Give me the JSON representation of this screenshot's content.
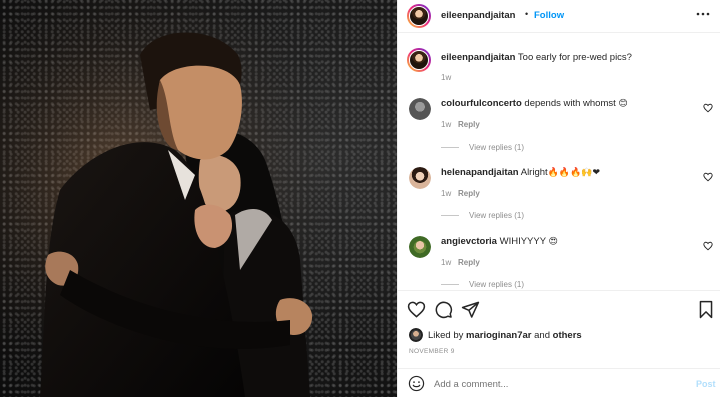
{
  "header": {
    "username": "eileenpandjaitan",
    "separator": "•",
    "follow_label": "Follow",
    "more_icon": "ellipsis-icon"
  },
  "caption": {
    "username": "eileenpandjaitan",
    "text": "Too early for pre-wed pics?",
    "time": "1w"
  },
  "comments": [
    {
      "username": "colourfulconcerto",
      "text": "depends with whomst",
      "emoji": "😊",
      "time": "1w",
      "reply_label": "Reply",
      "view_replies": "View replies (1)"
    },
    {
      "username": "helenapandjaitan",
      "text": "Alright",
      "emoji": "🔥🔥🔥🙌❤",
      "time": "1w",
      "reply_label": "Reply",
      "view_replies": "View replies (1)"
    },
    {
      "username": "angievctoria",
      "text": "WIHIYYYY",
      "emoji": "😍",
      "time": "1w",
      "reply_label": "Reply",
      "view_replies": "View replies (1)"
    }
  ],
  "actions": {
    "like_icon": "heart-icon",
    "comment_icon": "comment-icon",
    "share_icon": "paper-plane-icon",
    "save_icon": "bookmark-icon"
  },
  "likes": {
    "prefix": "Liked by",
    "user": "marioginan7ar",
    "conjunction": "and",
    "others": "others"
  },
  "date": "NOVEMBER 9",
  "add_comment": {
    "placeholder": "Add a comment...",
    "post_label": "Post",
    "emoji_icon": "smiley-icon"
  },
  "colors": {
    "link": "#0095f6",
    "post_disabled": "#b2dffc",
    "muted": "#8e8e8e"
  }
}
